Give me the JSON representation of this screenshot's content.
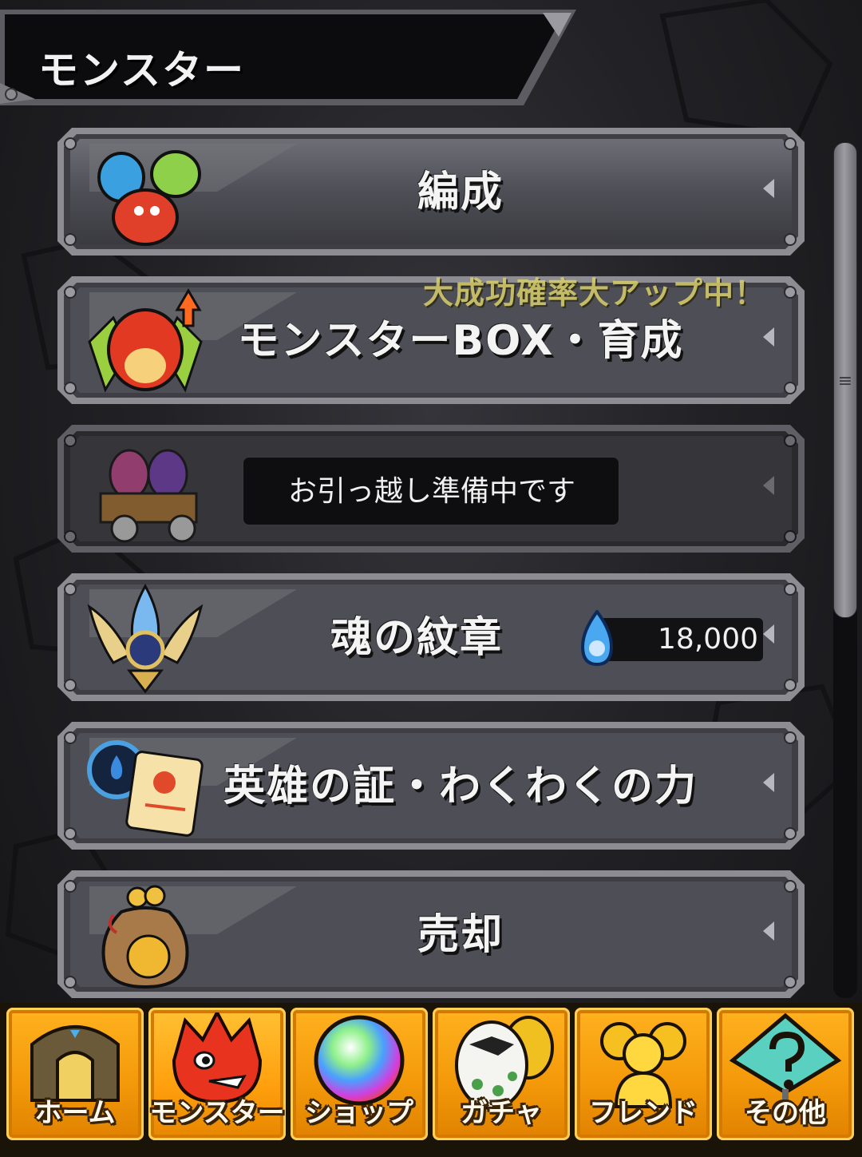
{
  "header": {
    "title": "モンスター"
  },
  "menu": {
    "items": [
      {
        "label": "編成",
        "icon": "monster-team-icon"
      },
      {
        "label": "モンスターBOX・育成",
        "icon": "dragon-powerup-icon",
        "promo": "大成功確率大アップ中！"
      },
      {
        "label": "",
        "icon": "egg-cart-icon",
        "tooltip": "お引っ越し準備中です",
        "disabled": true
      },
      {
        "label": "魂の紋章",
        "icon": "soul-emblem-icon",
        "counter": "18,000",
        "counter_icon": "blue-flame-icon"
      },
      {
        "label": "英雄の証・わくわくの力",
        "icon": "hero-scroll-icon"
      },
      {
        "label": "売却",
        "icon": "coin-bag-icon"
      }
    ]
  },
  "nav": {
    "items": [
      {
        "label": "ホーム",
        "icon": "home-gate-icon"
      },
      {
        "label": "モンスター",
        "icon": "red-monster-icon",
        "active": true
      },
      {
        "label": "ショップ",
        "icon": "rainbow-orb-icon"
      },
      {
        "label": "ガチャ",
        "icon": "egg-icon"
      },
      {
        "label": "フレンド",
        "icon": "friends-icon"
      },
      {
        "label": "その他",
        "icon": "question-sign-icon"
      }
    ]
  },
  "colors": {
    "accent_orange": "#f49a0a",
    "promo_yellow": "#d8cf6a",
    "plate_gray": "#5a5a62"
  }
}
